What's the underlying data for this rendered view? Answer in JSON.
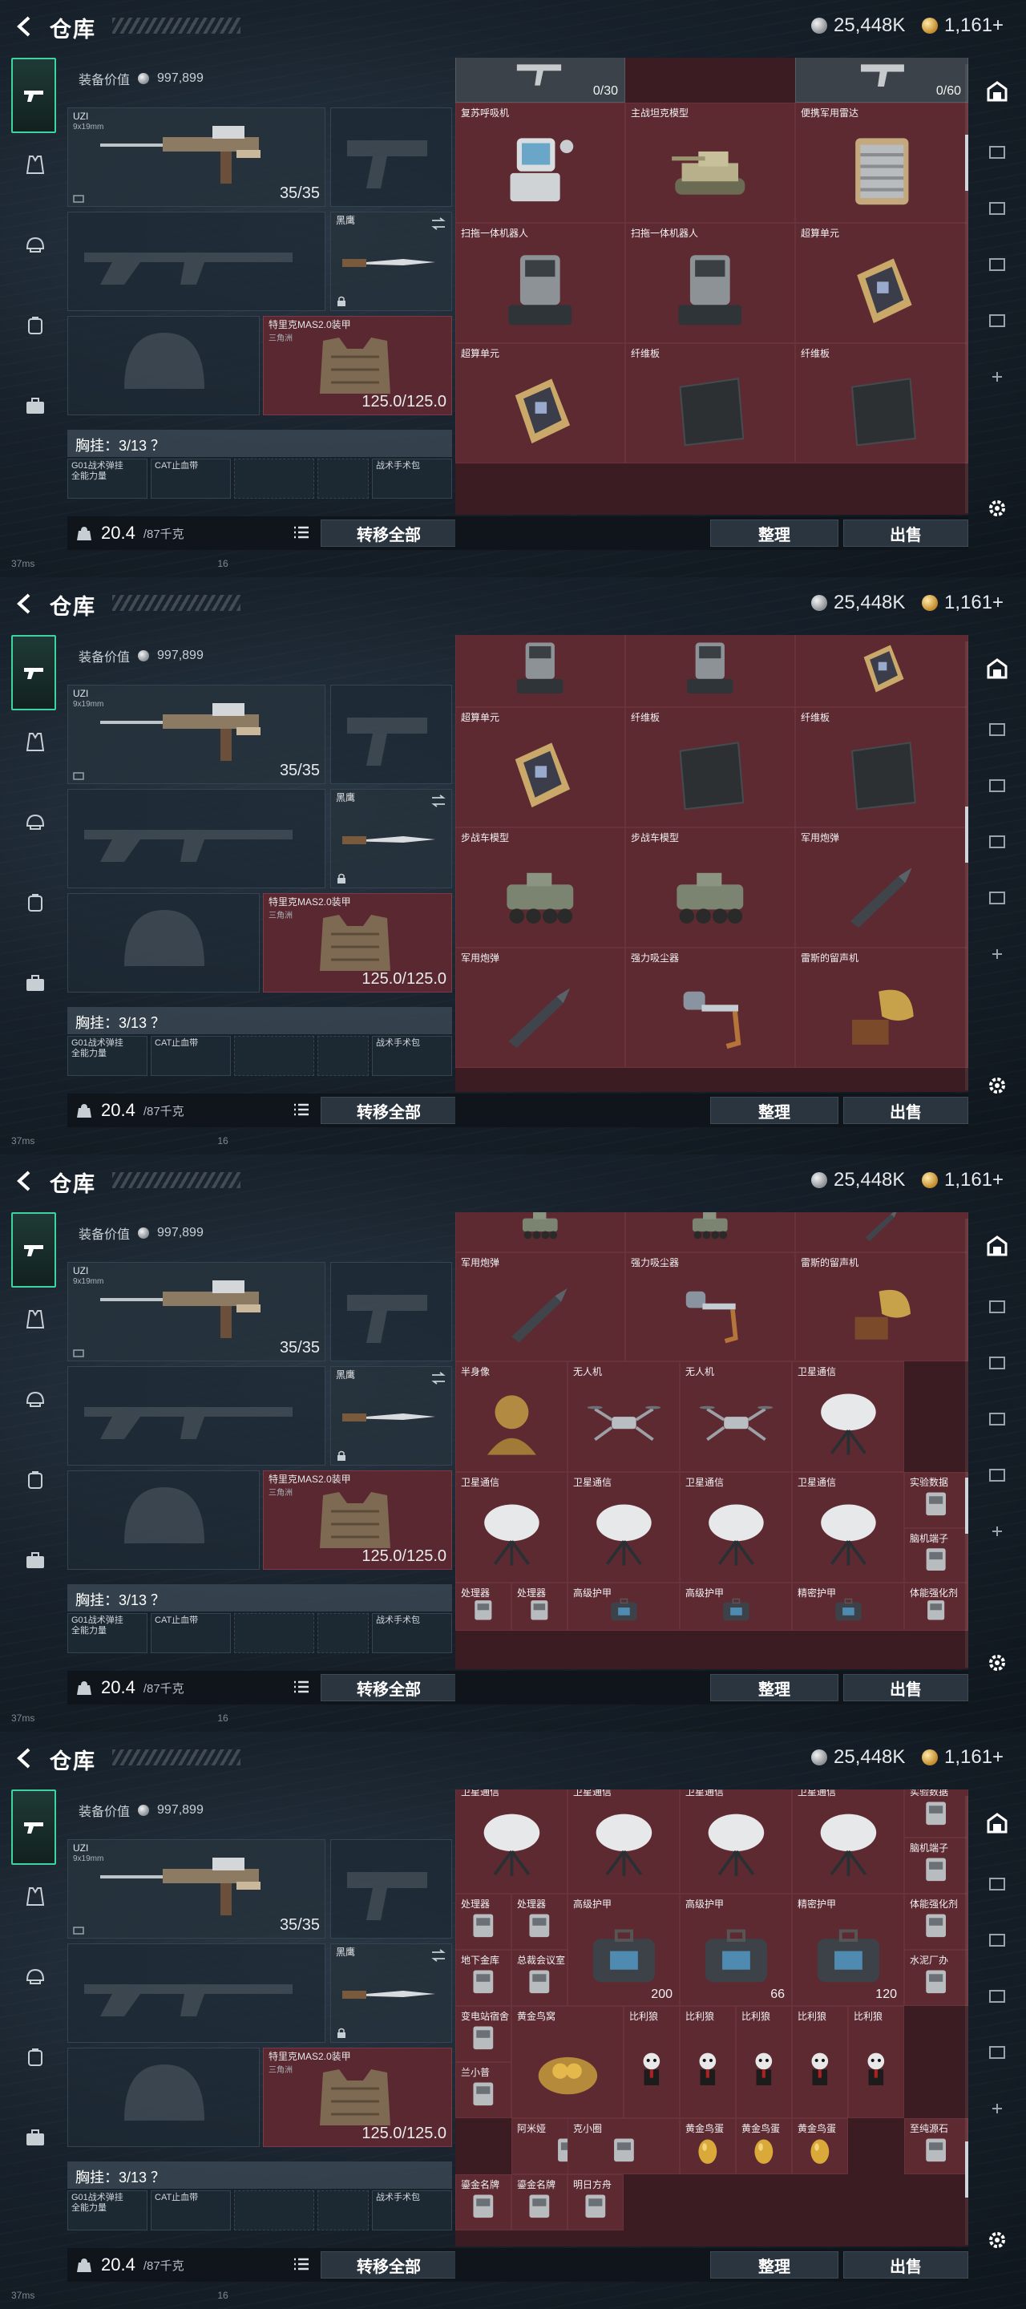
{
  "app": {
    "title": "仓库",
    "currency_silver": "25,448K",
    "currency_gold": "1,161+",
    "back_icon": "back-arrow-icon"
  },
  "equipment": {
    "value_label": "装备价值",
    "value": "997,899",
    "primary_weapon": {
      "name": "UZI",
      "caliber": "9x19mm",
      "ammo": "35/35"
    },
    "melee": {
      "name": "黑鹰"
    },
    "armor": {
      "name": "特里克MAS2.0装甲",
      "sub": "三角洲",
      "durability": "125.0/125.0"
    },
    "chest_label": "胸挂：3/13 ？",
    "chest_slots": [
      {
        "label": "G01战术弹挂\n全能力量"
      },
      {
        "label": "CAT止血带"
      },
      {
        "label": "战术手术包"
      }
    ],
    "weight": "20.4",
    "weight_unit": "/87千克",
    "transfer_all": "转移全部"
  },
  "inventory": {
    "sort_label": "整理",
    "sell_label": "出售"
  },
  "footer": {
    "ping": "37ms",
    "page": "16"
  },
  "panels": [
    {
      "scroll_thumb": 0.18,
      "cells": [
        {
          "label": "",
          "count": "0/30",
          "art": "rifle",
          "color": "gray"
        },
        {
          "label": "",
          "count": "0/60",
          "art": "rifle2",
          "color": "gray"
        },
        {
          "label": "复苏呼吸机",
          "art": "monitor"
        },
        {
          "label": "主战坦克模型",
          "art": "tank"
        },
        {
          "label": "便携军用雷达",
          "art": "radar"
        },
        {
          "label": "扫拖一体机器人",
          "art": "robot"
        },
        {
          "label": "扫拖一体机器人",
          "art": "robot"
        },
        {
          "label": "超算单元",
          "art": "chip"
        },
        {
          "label": "超算单元",
          "art": "chip"
        },
        {
          "label": "纤维板",
          "art": "board"
        },
        {
          "label": "纤维板",
          "art": "board"
        }
      ]
    },
    {
      "scroll_thumb": 0.42,
      "cells": [
        {
          "label": "",
          "art": "robot"
        },
        {
          "label": "",
          "art": "robot"
        },
        {
          "label": "",
          "art": "chip"
        },
        {
          "label": "超算单元",
          "art": "chip"
        },
        {
          "label": "纤维板",
          "art": "board"
        },
        {
          "label": "纤维板",
          "art": "board"
        },
        {
          "label": "步战车模型",
          "art": "apc"
        },
        {
          "label": "步战车模型",
          "art": "apc"
        },
        {
          "label": "军用炮弹",
          "art": "shell"
        },
        {
          "label": "军用炮弹",
          "art": "shell"
        },
        {
          "label": "强力吸尘器",
          "art": "vacuum"
        },
        {
          "label": "雷斯的留声机",
          "art": "phonograph"
        }
      ]
    },
    {
      "scroll_thumb": 0.66,
      "cells": [
        {
          "label": "",
          "art": "apc"
        },
        {
          "label": "",
          "art": "apc"
        },
        {
          "label": "",
          "art": "shell"
        },
        {
          "label": "军用炮弹",
          "art": "shell"
        },
        {
          "label": "强力吸尘器",
          "art": "vacuum"
        },
        {
          "label": "雷斯的留声机",
          "art": "phonograph"
        },
        {
          "label": "半身像",
          "art": "bust"
        },
        {
          "label": "无人机",
          "art": "drone"
        },
        {
          "label": "无人机",
          "art": "drone"
        },
        {
          "label": "卫星通信",
          "art": "dish"
        },
        {
          "label": "卫星通信",
          "art": "dish"
        },
        {
          "label": "卫星通信",
          "art": "dish"
        },
        {
          "label": "卫星通信",
          "art": "dish"
        },
        {
          "label": "卫星通信",
          "art": "dish"
        },
        {
          "label": "实验数据",
          "art": "small"
        },
        {
          "label": "脑机端子",
          "art": "small"
        },
        {
          "label": "处理器",
          "art": "small"
        },
        {
          "label": "处理器",
          "art": "small"
        },
        {
          "label": "高级护甲",
          "art": "case"
        },
        {
          "label": "高级护甲",
          "art": "case"
        },
        {
          "label": "精密护甲",
          "art": "case"
        },
        {
          "label": "体能强化剂",
          "art": "small"
        }
      ]
    },
    {
      "scroll_thumb": 0.88,
      "cells": [
        {
          "label": "卫星通信",
          "art": "dish"
        },
        {
          "label": "卫星通信",
          "art": "dish"
        },
        {
          "label": "卫星通信",
          "art": "dish"
        },
        {
          "label": "卫星通信",
          "art": "dish"
        },
        {
          "label": "实验数据",
          "art": "small"
        },
        {
          "label": "脑机端子",
          "art": "small"
        },
        {
          "label": "处理器",
          "art": "small"
        },
        {
          "label": "处理器",
          "art": "small"
        },
        {
          "label": "高级护甲",
          "art": "case",
          "count": "200"
        },
        {
          "label": "高级护甲",
          "art": "case",
          "count": "66"
        },
        {
          "label": "精密护甲",
          "art": "case",
          "count": "120"
        },
        {
          "label": "体能强化剂",
          "art": "small"
        },
        {
          "label": "地下金库",
          "art": "small"
        },
        {
          "label": "总裁会议室",
          "art": "small"
        },
        {
          "label": "水泥厂办",
          "art": "small"
        },
        {
          "label": "变电站宿舍",
          "art": "small"
        },
        {
          "label": "黄金鸟窝",
          "art": "nest"
        },
        {
          "label": "比利狼",
          "art": "doll"
        },
        {
          "label": "比利狼",
          "art": "doll"
        },
        {
          "label": "比利狼",
          "art": "doll"
        },
        {
          "label": "比利狼",
          "art": "doll"
        },
        {
          "label": "比利狼",
          "art": "doll"
        },
        {
          "label": "兰小普",
          "art": "small"
        },
        {
          "label": "阿米娅",
          "art": "small"
        },
        {
          "label": "克小圈",
          "art": "small"
        },
        {
          "label": "黄金鸟蛋",
          "art": "egg"
        },
        {
          "label": "黄金鸟蛋",
          "art": "egg"
        },
        {
          "label": "黄金鸟蛋",
          "art": "egg"
        },
        {
          "label": "至纯源石",
          "art": "small"
        },
        {
          "label": "鎏金名牌",
          "art": "small"
        },
        {
          "label": "鎏金名牌",
          "art": "small"
        },
        {
          "label": "明日方舟",
          "art": "small"
        }
      ]
    }
  ]
}
